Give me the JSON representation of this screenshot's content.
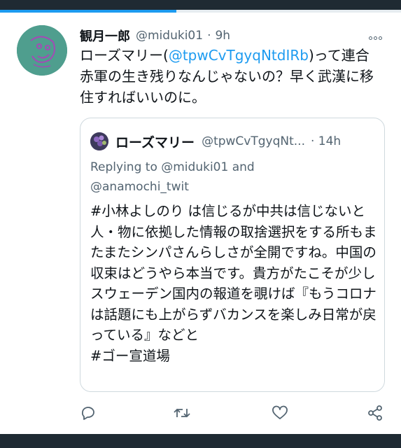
{
  "tweet": {
    "display_name": "観月一郎",
    "handle": "@miduki01",
    "dot": "·",
    "time": "9h",
    "text_prefix": "ローズマリー(",
    "mention": "@tpwCvTgyqNtdIRb",
    "text_suffix": ")って連合赤軍の生き残りなんじゃないの？早く武漢に移住すればいいのに。"
  },
  "quote": {
    "display_name": "ローズマリー",
    "handle": "@tpwCvTgyqNt...",
    "time": "· 14h",
    "replying_prefix": "Replying to ",
    "replying_user1": "@miduki01",
    "replying_and": " and",
    "replying_user2": "@anamochi_twit",
    "text": "#小林よしのり は信じるが中共は信じないと人・物に依拠した情報の取捨選択をする所もまたまたシンパさんらしさが全開ですね。中国の収束はどうやら本当です。貴方がたこそが少しスウェーデン国内の報道を覗けば『もうコロナは話題にも上がらずバカンスを楽しみ日常が戻っている』などと\n#ゴー宣道場"
  },
  "actions": [
    "reply-icon",
    "retweet-icon",
    "like-icon",
    "share-icon"
  ],
  "colors": {
    "accent": "#1d9bf0",
    "text": "#0f1419",
    "muted": "#536471",
    "bar": "#1f2a33"
  },
  "loading_progress": 0.44
}
